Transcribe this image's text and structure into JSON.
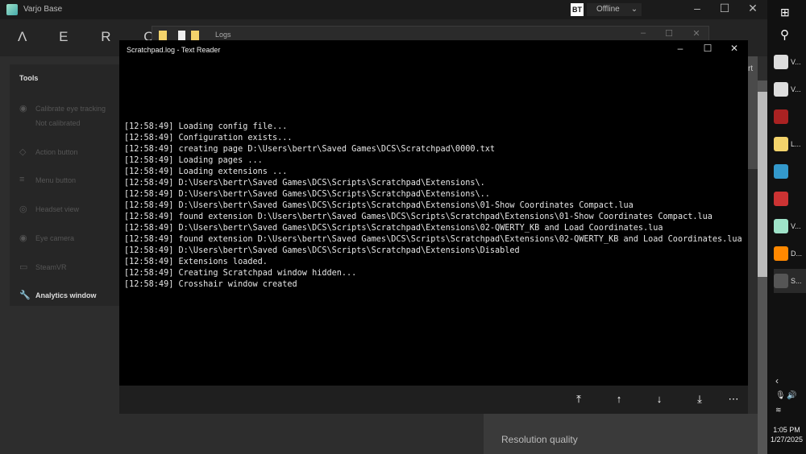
{
  "varjo": {
    "title": "Varjo Base",
    "logo": "Λ E R O",
    "status": "Offline",
    "badge": "BT",
    "partial_tab": "rt",
    "tools_title": "Tools",
    "tools": [
      {
        "label": "Calibrate eye tracking",
        "sub": "Not calibrated",
        "icon": "eye-icon"
      },
      {
        "label": "Action button",
        "icon": "diamond-icon"
      },
      {
        "label": "Menu button",
        "icon": "menu-icon"
      },
      {
        "label": "Headset view",
        "icon": "headset-icon"
      },
      {
        "label": "Eye camera",
        "icon": "eye-camera-icon"
      },
      {
        "label": "SteamVR",
        "icon": "steamvr-icon"
      },
      {
        "label": "Analytics window",
        "icon": "wrench-icon"
      }
    ],
    "resolution_title": "Resolution quality"
  },
  "explorer": {
    "title": "Logs"
  },
  "reader": {
    "title": "Scratchpad.log - Text Reader",
    "lines": [
      "[12:58:49] Loading config file...",
      "[12:58:49] Configuration exists...",
      "[12:58:49] creating page D:\\Users\\bertr\\Saved Games\\DCS\\Scratchpad\\0000.txt",
      "[12:58:49] Loading pages ...",
      "[12:58:49] Loading extensions ...",
      "[12:58:49] D:\\Users\\bertr\\Saved Games\\DCS\\Scripts\\Scratchpad\\Extensions\\.",
      "[12:58:49] D:\\Users\\bertr\\Saved Games\\DCS\\Scripts\\Scratchpad\\Extensions\\..",
      "[12:58:49] D:\\Users\\bertr\\Saved Games\\DCS\\Scripts\\Scratchpad\\Extensions\\01-Show Coordinates Compact.lua",
      "[12:58:49] found extension D:\\Users\\bertr\\Saved Games\\DCS\\Scripts\\Scratchpad\\Extensions\\01-Show Coordinates Compact.lua",
      "[12:58:49] D:\\Users\\bertr\\Saved Games\\DCS\\Scripts\\Scratchpad\\Extensions\\02-QWERTY_KB and Load Coordinates.lua",
      "[12:58:49] found extension D:\\Users\\bertr\\Saved Games\\DCS\\Scripts\\Scratchpad\\Extensions\\02-QWERTY_KB and Load Coordinates.lua",
      "[12:58:49] D:\\Users\\bertr\\Saved Games\\DCS\\Scripts\\Scratchpad\\Extensions\\Disabled",
      "[12:58:49] Extensions loaded.",
      "[12:58:49] Creating Scratchpad window hidden...",
      "[12:58:49] Crosshair window created"
    ]
  },
  "taskbar": {
    "items": [
      "V...",
      "V...",
      "",
      "L...",
      "",
      "",
      "V...",
      "D...",
      "S..."
    ],
    "time": "1:05 PM",
    "date": "1/27/2025"
  }
}
